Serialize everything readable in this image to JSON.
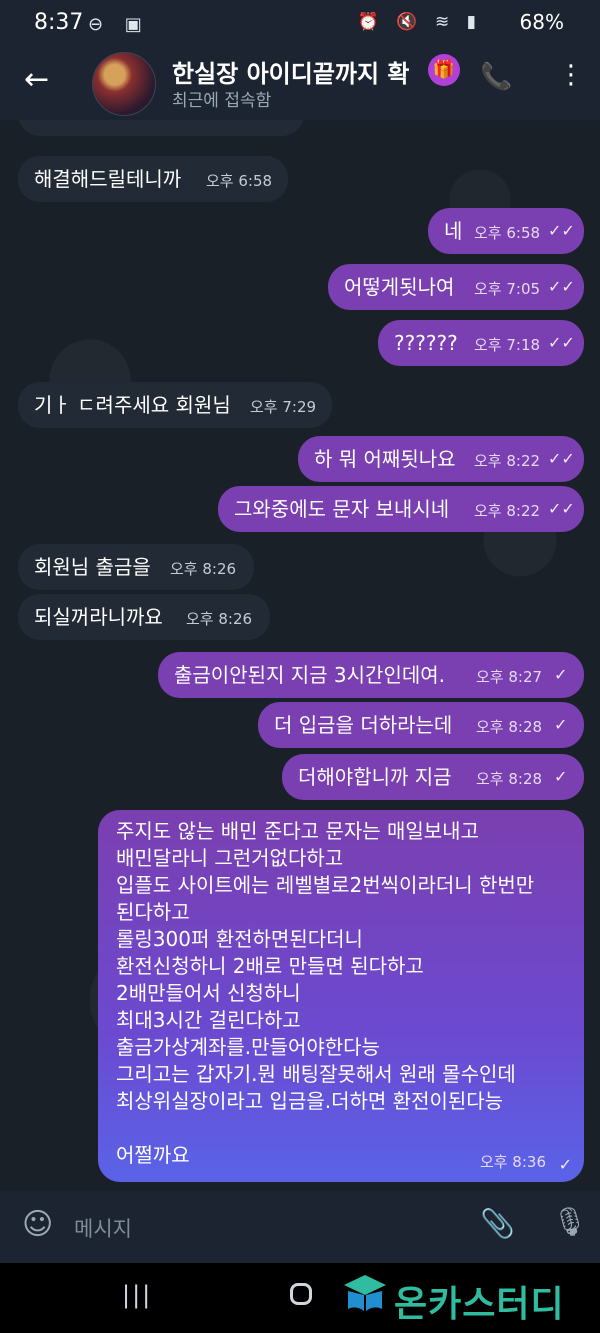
{
  "status_bar": {
    "time": "8:37",
    "left_icons": "⊖ ▣",
    "right_icons": "⏰ 🔇 ≋ ▮",
    "battery": "68%"
  },
  "header": {
    "title": "한실장 아이디끝까지 확",
    "subtitle": "최근에 접속함",
    "gift_icon": "gift-icon"
  },
  "messages": [
    {
      "text": "해결해드릴테니까",
      "time": "오후 6:58"
    },
    {
      "text": "네",
      "time": "오후 6:58"
    },
    {
      "text": "어떻게됫나여",
      "time": "오후 7:05"
    },
    {
      "text": "??????",
      "time": "오후 7:18"
    },
    {
      "text": "기ㅏ ㄷ려주세요 회원님",
      "time": "오후 7:29"
    },
    {
      "text": "하 뭐 어째됫나요",
      "time": "오후 8:22"
    },
    {
      "text": "그와중에도 문자 보내시네",
      "time": "오후 8:22"
    },
    {
      "text": "회원님 출금을",
      "time": "오후 8:26"
    },
    {
      "text": "되실꺼라니까요",
      "time": "오후 8:26"
    },
    {
      "text": "출금이안된지 지금 3시간인데여.",
      "time": "오후 8:27"
    },
    {
      "text": "더 입금을 더하라는데",
      "time": "오후 8:28"
    },
    {
      "text": "더해야합니까 지금",
      "time": "오후 8:28"
    }
  ],
  "big_message": {
    "lines": [
      "주지도 않는 배민 준다고 문자는 매일보내고",
      "배민달라니 그런거없다하고",
      "입플도 사이트에는 레벨별로2번씩이라더니 한번만",
      "된다하고",
      "롤링300퍼 환전하면된다더니",
      "환전신청하니 2배로 만들면 된다하고",
      "2배만들어서 신청하니",
      "최대3시간 걸린다하고",
      "출금가상계좌를.만들어야한다능",
      "그리고는 갑자기.뭔 배팅잘못해서 원래 몰수인데",
      "최상위실장이라고 입금을.더하면 환전이된다능",
      "",
      "어쩔까요"
    ],
    "time": "오후 8:36"
  },
  "input": {
    "placeholder": "메시지"
  },
  "watermark": {
    "text": "온카스터디"
  },
  "colors": {
    "outgoing": "#7a3fb0",
    "incoming": "#222b35",
    "accent": "#2fbca0"
  }
}
